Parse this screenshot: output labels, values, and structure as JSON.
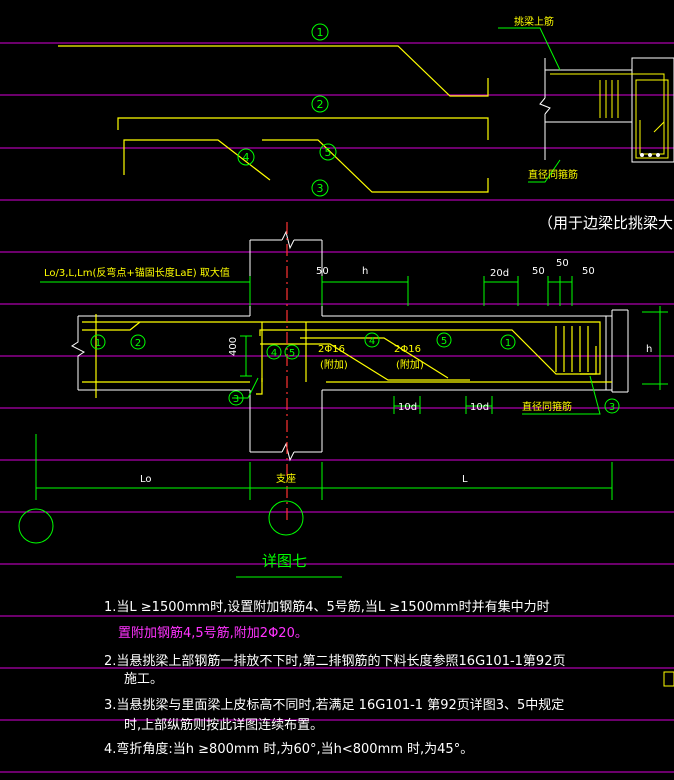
{
  "labels": {
    "overhang_top_rebar": "挑梁上筋",
    "edge_beam_stirrup_top": "直径同箍筋",
    "note_edge_beam": "（用于边梁比挑梁大时）",
    "anchor_formula": "Lo/3,L,Lm(反弯点+锚固长度LaE) 取大值",
    "dim_50_a": "50",
    "dim_h_top": "h",
    "dim_20d": "20d",
    "dim_50_b": "50",
    "dim_50_c": "50",
    "dim_50_d": "50",
    "dim_400": "400",
    "bar_2phi16_a": "2Φ16",
    "bar_added_a": "(附加)",
    "bar_2phi16_b": "2Φ16",
    "bar_added_b": "(附加)",
    "dim_10d_a": "10d",
    "dim_10d_b": "10d",
    "edge_stirrup_bottom": "直径同箍筋",
    "dim_h_right": "h",
    "span_lo": "Lo",
    "support": "支座",
    "span_l": "L",
    "detail_title": "详图七"
  },
  "markers": {
    "m1_top": "1",
    "m2_top": "2",
    "m5_top": "5",
    "m4_top": "4",
    "m3_top": "3",
    "m1_left": "1",
    "m2_left": "2",
    "m4_mid": "4",
    "m5_mid": "5",
    "m4_beam": "4",
    "m5_beam": "5",
    "m1_right": "1",
    "m3_left": "3",
    "m3_right": "3"
  },
  "notes": [
    "1.当L ≥1500mm时,设置附加钢筋4、5号筋,当L ≥1500mm时并有集中力时",
    "置附加钢筋4,5号筋,附加2Φ20。",
    "2.当悬挑梁上部钢筋一排放不下时,第二排钢筋的下料长度参照16G101-1第92页",
    "施工。",
    "3.当悬挑梁与里面梁上皮标高不同时,若满足 16G101-1 第92页详图3、5中规定",
    "时,上部纵筋则按此详图连续布置。",
    "4.弯折角度:当h ≥800mm 时,为60°,当h<800mm 时,为45°。"
  ],
  "colors": {
    "background": "#000000",
    "rebar": "#ffff00",
    "dimension": "#00ff00",
    "outline": "#ffffff",
    "centerline": "#ff0000",
    "gridline": "#ff00ff",
    "magenta_text": "#ff33ff"
  }
}
